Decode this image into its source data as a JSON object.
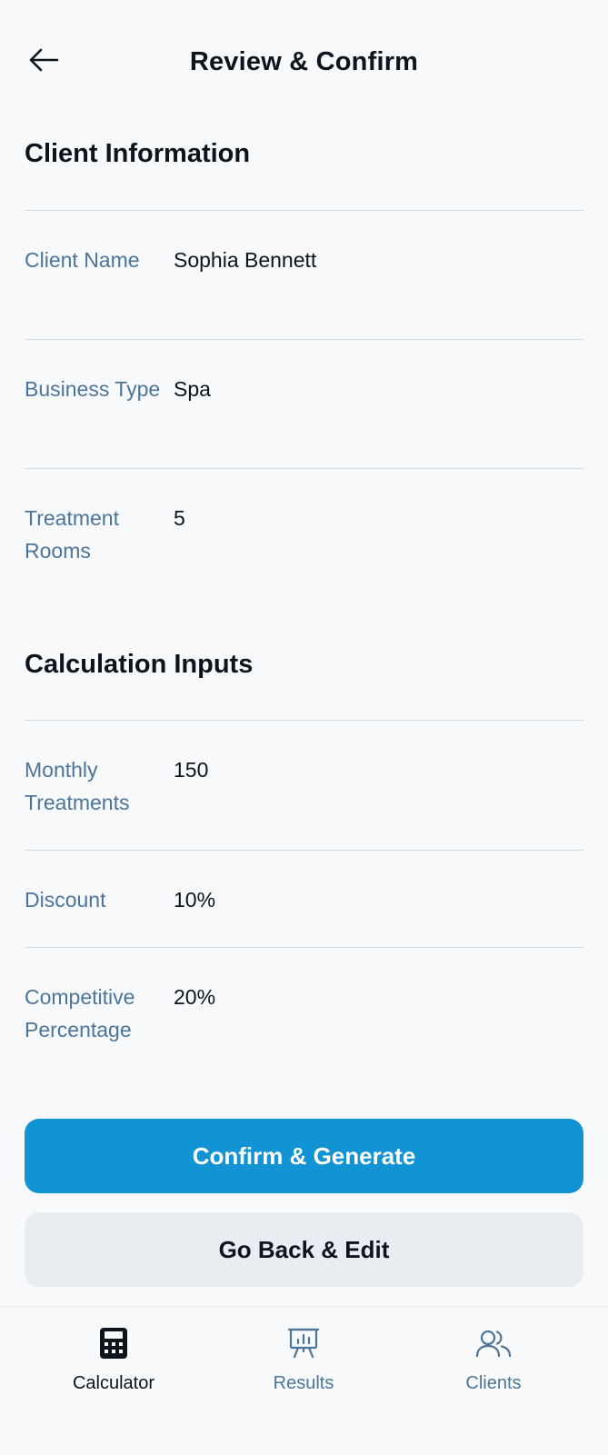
{
  "header": {
    "title": "Review & Confirm",
    "back_icon": "arrow-left-icon"
  },
  "client_info": {
    "heading": "Client Information",
    "rows": [
      {
        "label": "Client Name",
        "value": "Sophia Bennett"
      },
      {
        "label": "Business Type",
        "value": "Spa"
      },
      {
        "label": "Treatment Rooms",
        "value": "5"
      }
    ]
  },
  "calc_inputs": {
    "heading": "Calculation Inputs",
    "rows": [
      {
        "label": "Monthly Treatments",
        "value": "150"
      },
      {
        "label": "Discount",
        "value": "10%"
      },
      {
        "label": "Competitive Percentage",
        "value": "20%"
      }
    ]
  },
  "actions": {
    "confirm_label": "Confirm & Generate",
    "edit_label": "Go Back & Edit"
  },
  "nav": {
    "items": [
      {
        "label": "Calculator",
        "icon": "calculator-icon",
        "active": true
      },
      {
        "label": "Results",
        "icon": "presentation-chart-icon",
        "active": false
      },
      {
        "label": "Clients",
        "icon": "users-icon",
        "active": false
      }
    ]
  },
  "colors": {
    "background": "#f7f9fb",
    "primary": "#1193d4",
    "secondary_button": "#e7edf0",
    "label": "#4d7599",
    "divider": "#cfdde8",
    "text": "#0d141c"
  }
}
